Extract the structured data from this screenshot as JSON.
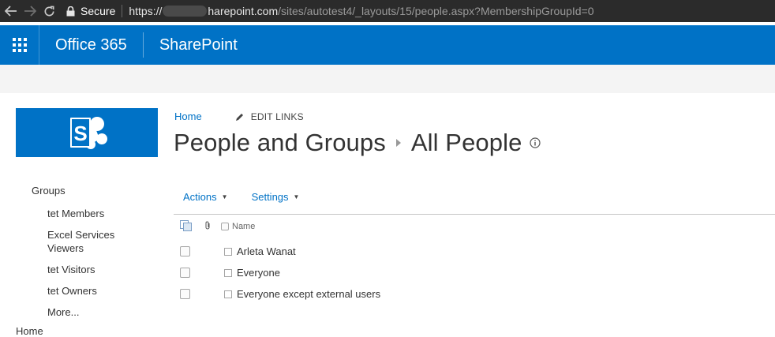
{
  "browser": {
    "secure_label": "Secure",
    "url_scheme": "https://",
    "url_host": "harepoint.com",
    "url_path": "/sites/autotest4/_layouts/15/people.aspx?MembershipGroupId=0"
  },
  "suitebar": {
    "suite_title": "Office 365",
    "app_title": "SharePoint"
  },
  "toplinks": {
    "home": "Home",
    "edit_links": "EDIT LINKS"
  },
  "page": {
    "title_part1": "People and Groups",
    "title_part2": "All People"
  },
  "leftnav": {
    "heading": "Groups",
    "items": [
      "tet Members",
      "Excel Services Viewers",
      "tet Visitors",
      "tet Owners",
      "More..."
    ],
    "bottom": "Home"
  },
  "commands": {
    "actions": "Actions",
    "settings": "Settings"
  },
  "list": {
    "name_header": "Name",
    "rows": [
      "Arleta Wanat",
      "Everyone",
      "Everyone except external users"
    ]
  },
  "colors": {
    "brand_blue": "#0072c6",
    "browser_bar": "#2b2b2b"
  }
}
